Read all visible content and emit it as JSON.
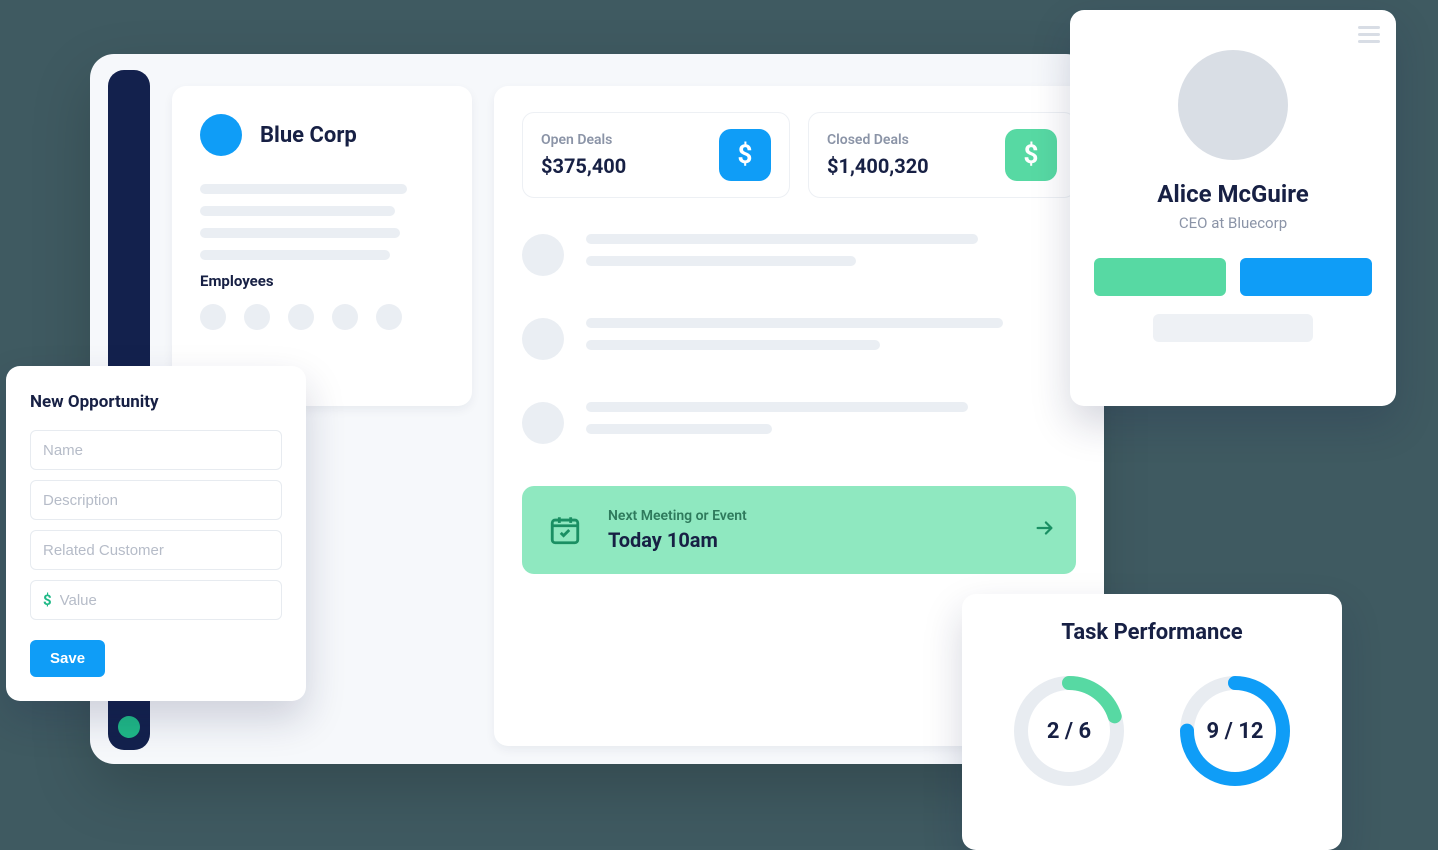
{
  "company": {
    "name": "Blue Corp",
    "employees_label": "Employees"
  },
  "deals": {
    "open": {
      "label": "Open Deals",
      "value": "$375,400"
    },
    "closed": {
      "label": "Closed Deals",
      "value": "$1,400,320"
    }
  },
  "event": {
    "caption": "Next Meeting or Event",
    "when": "Today 10am"
  },
  "opportunity": {
    "title": "New Opportunity",
    "fields": {
      "name": "Name",
      "description": "Description",
      "related": "Related Customer",
      "value": "Value"
    },
    "save": "Save"
  },
  "profile": {
    "name": "Alice McGuire",
    "subtitle": "CEO at Bluecorp"
  },
  "performance": {
    "title": "Task Performance",
    "metrics": [
      {
        "done": 2,
        "total": 6,
        "label": "2 / 6",
        "color": "#57d9a3",
        "pct": 0.2
      },
      {
        "done": 9,
        "total": 12,
        "label": "9 / 12",
        "color": "#0f9df7",
        "pct": 0.75
      }
    ]
  },
  "colors": {
    "blue": "#0f9df7",
    "green": "#57d9a3",
    "navy": "#13214d"
  }
}
